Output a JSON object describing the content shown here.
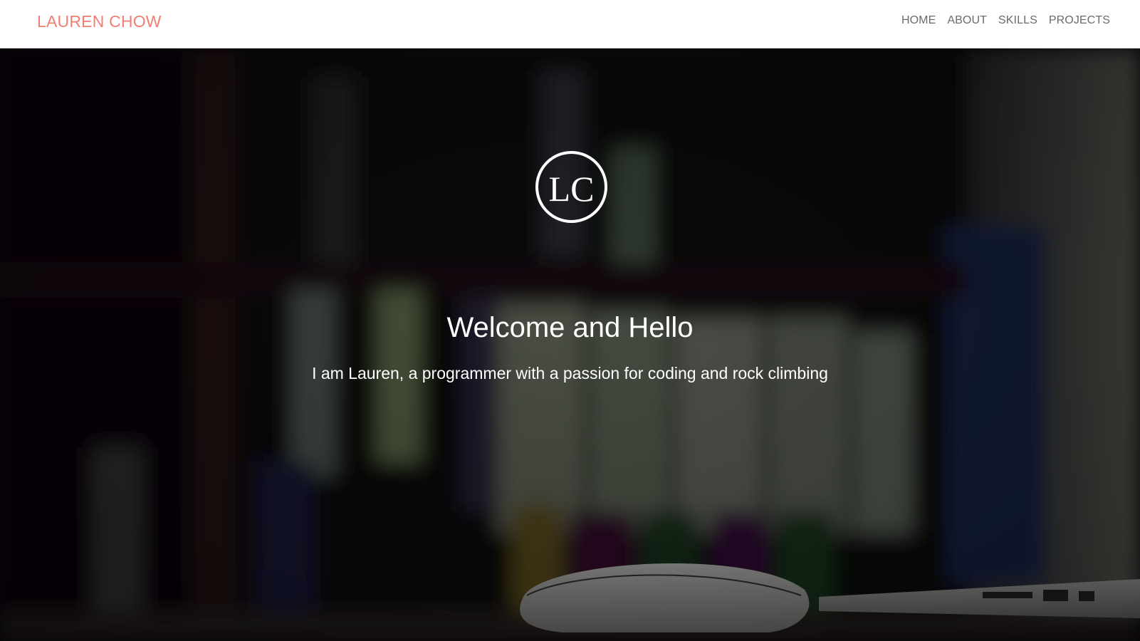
{
  "navbar": {
    "brand": "LAUREN CHOW",
    "links": [
      "HOME",
      "ABOUT",
      "SKILLS",
      "PROJECTS"
    ]
  },
  "hero": {
    "logo_text": "LC",
    "title": "Welcome and Hello",
    "subtitle": "I am Lauren, a programmer with a passion for coding and rock climbing",
    "background_description_icon": "bookshelf-desk-photo"
  },
  "colors": {
    "brand": "#f07f73",
    "nav_text": "#6b6b6b",
    "hero_text": "#ffffff"
  }
}
